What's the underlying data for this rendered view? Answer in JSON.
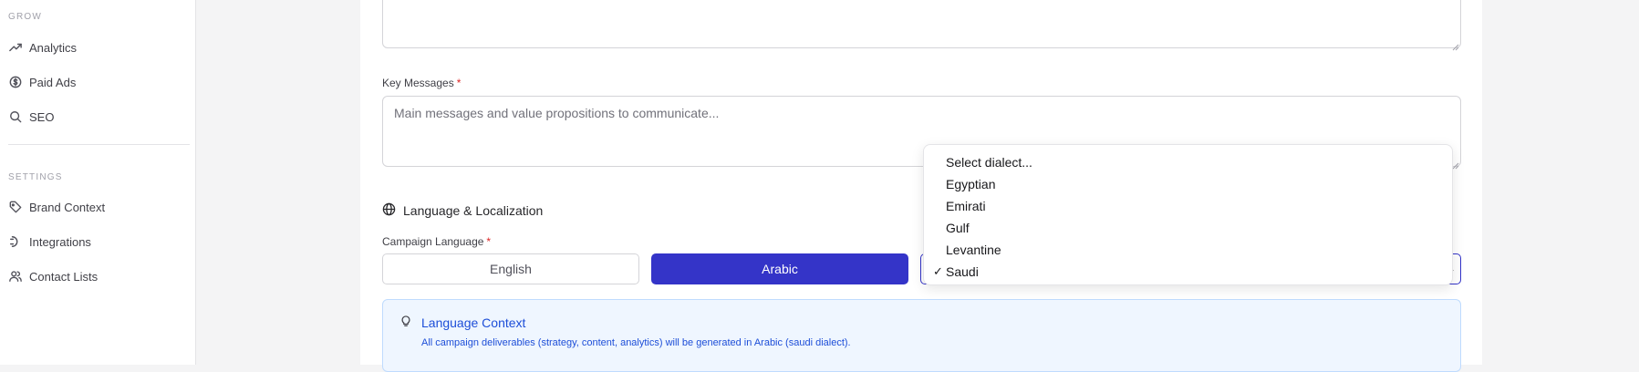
{
  "sidebar": {
    "grow_label": "GROW",
    "grow_items": [
      {
        "label": "Analytics",
        "icon": "trending-up-icon"
      },
      {
        "label": "Paid Ads",
        "icon": "dollar-circle-icon"
      },
      {
        "label": "SEO",
        "icon": "search-icon"
      }
    ],
    "settings_label": "SETTINGS",
    "settings_items": [
      {
        "label": "Brand Context",
        "icon": "tag-icon"
      },
      {
        "label": "Integrations",
        "icon": "plug-icon"
      },
      {
        "label": "Contact Lists",
        "icon": "users-icon"
      }
    ]
  },
  "form": {
    "key_messages_label": "Key Messages",
    "required_mark": "*",
    "key_messages_placeholder": "Main messages and value propositions to communicate...",
    "language_section_title": "Language & Localization",
    "campaign_language_label": "Campaign Language",
    "language_options": [
      "English",
      "Arabic"
    ],
    "selected_language": "Arabic",
    "dialect_dropdown": {
      "options": [
        "Select dialect...",
        "Egyptian",
        "Emirati",
        "Gulf",
        "Levantine",
        "Saudi"
      ],
      "selected": "Saudi",
      "check_glyph": "✓"
    },
    "info": {
      "title": "Language Context",
      "text": "All campaign deliverables (strategy, content, analytics) will be generated in Arabic (saudi dialect)."
    }
  },
  "colors": {
    "accent": "#3434c8",
    "info_bg": "#eff6ff",
    "info_text": "#1d4ed8",
    "required": "#dc2626"
  }
}
